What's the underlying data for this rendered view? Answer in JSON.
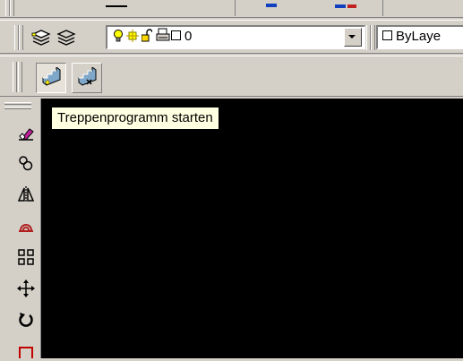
{
  "layers_toolbar": {
    "layer_combo_value": "0",
    "linetype_combo_value": "ByLaye"
  },
  "tooltip": {
    "text": "Treppenprogramm starten"
  },
  "icons": {
    "layer_manager": "layer-manager-icon",
    "layer_previous": "layer-previous-icon",
    "layer_on": "lightbulb-icon",
    "layer_thaw": "sun-icon",
    "layer_unlocked": "unlocked-padlock-icon",
    "layer_plot": "printer-icon",
    "layer_color": "color-swatch-icon",
    "stair_start": "stair-start-icon",
    "stair_edit": "stair-edit-icon",
    "erase": "eraser-icon",
    "copy": "copy-object-icon",
    "mirror": "mirror-icon",
    "offset": "offset-icon",
    "array": "array-icon",
    "move": "move-icon",
    "rotate": "rotate-icon",
    "scale": "scale-icon"
  },
  "colors": {
    "chrome": "#d4d0c8",
    "canvas": "#000000",
    "tooltip_bg": "#ffffe1",
    "bulb": "#ffff00",
    "eraser": "#c0209a"
  }
}
